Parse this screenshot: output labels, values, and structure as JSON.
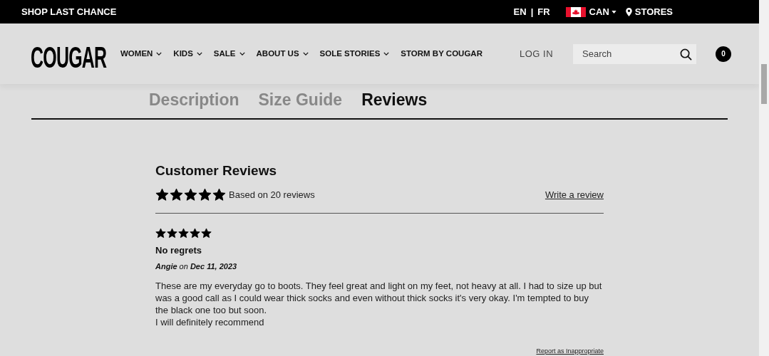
{
  "top_bar": {
    "promo": "SHOP LAST CHANCE",
    "languages": [
      "EN",
      "FR"
    ],
    "language_separator": "|",
    "country": "CAN",
    "stores": "STORES"
  },
  "header": {
    "logo": "COUGAR",
    "nav": [
      {
        "label": "WOMEN",
        "has_menu": true
      },
      {
        "label": "KIDS",
        "has_menu": true
      },
      {
        "label": "SALE",
        "has_menu": true
      },
      {
        "label": "ABOUT US",
        "has_menu": true
      },
      {
        "label": "SOLE STORIES",
        "has_menu": true
      },
      {
        "label": "STORM BY COUGAR",
        "has_menu": false
      }
    ],
    "login": "LOG IN",
    "search": {
      "placeholder": "Search"
    },
    "cart_count": "0"
  },
  "tabs": [
    {
      "label": "Description",
      "selected": false
    },
    {
      "label": "Size Guide",
      "selected": false
    },
    {
      "label": "Reviews",
      "selected": true
    }
  ],
  "reviews": {
    "title": "Customer Reviews",
    "stars": 5,
    "summary": "Based on 20 reviews",
    "write_link": "Write a review",
    "items": [
      {
        "stars": 5,
        "title": "No regrets",
        "byline": "**Angie** on **Dec 11, 2023**",
        "body": "These are my everyday go to boots. They feel great and light on my feet, not heavy at all. I had to size up but was a good call as I could wear thick socks and even without thick socks it's very okay. I'm tempted to buy the black one too but soon.\nI will definitely recommend",
        "report": "Report as Inappropriate"
      }
    ]
  }
}
